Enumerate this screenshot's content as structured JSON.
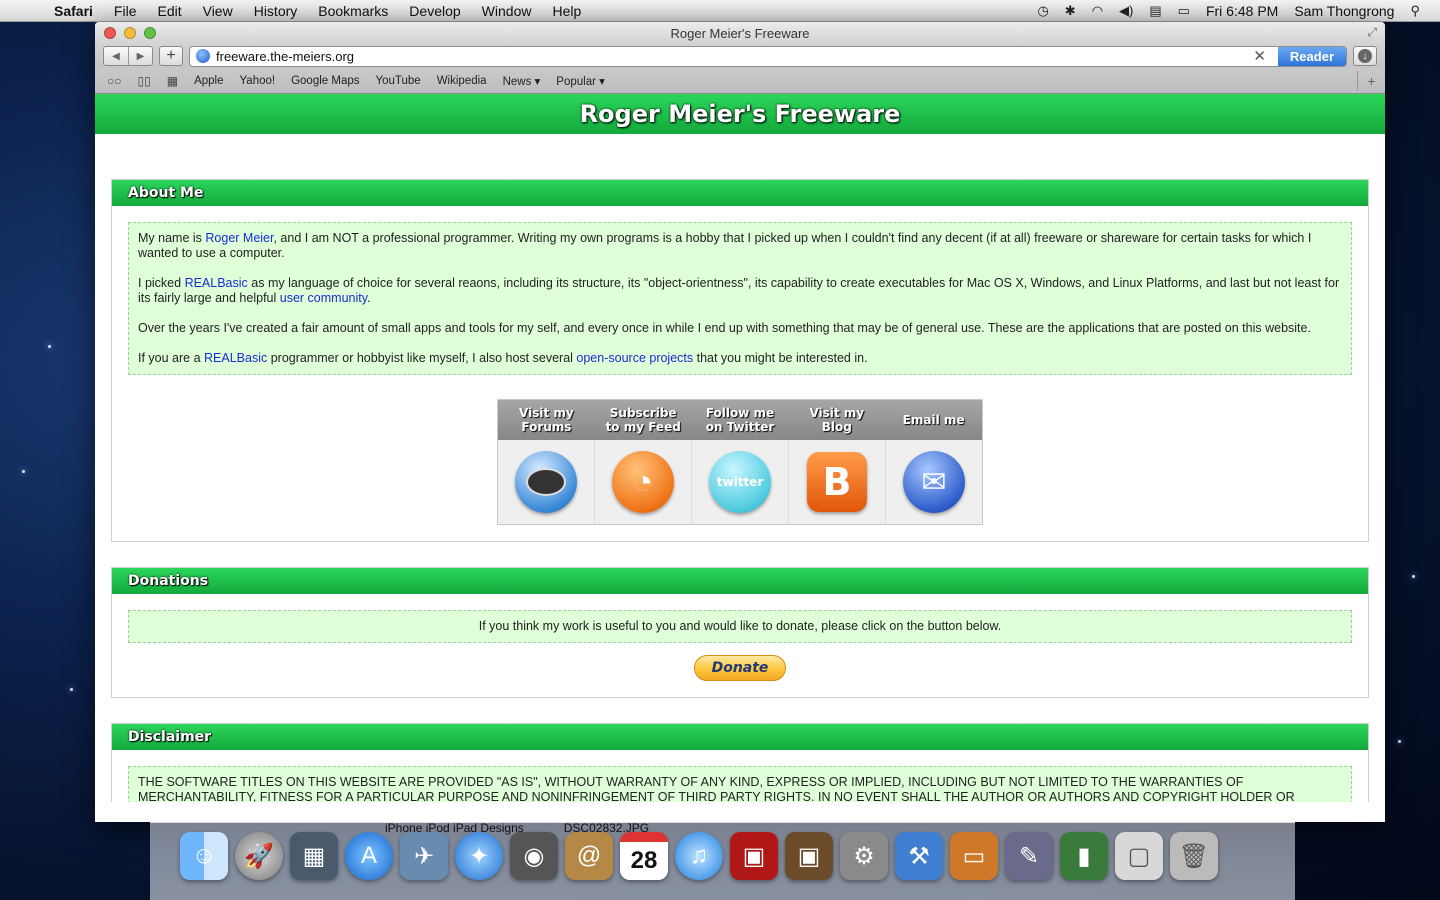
{
  "menubar": {
    "app": "Safari",
    "items": [
      "File",
      "Edit",
      "View",
      "History",
      "Bookmarks",
      "Develop",
      "Window",
      "Help"
    ],
    "clock": "Fri 6:48 PM",
    "user": "Sam Thongrong",
    "icons": [
      "time-machine-icon",
      "bluetooth-icon",
      "wifi-icon",
      "volume-icon",
      "flag-icon",
      "battery-icon",
      "spotlight-icon"
    ]
  },
  "window": {
    "title": "Roger Meier's Freeware",
    "url": "freeware.the-meiers.org",
    "reader_label": "Reader"
  },
  "bookmarks": [
    "Apple",
    "Yahoo!",
    "Google Maps",
    "YouTube",
    "Wikipedia",
    "News ▾",
    "Popular ▾"
  ],
  "site": {
    "title": "Roger Meier's Freeware",
    "about": {
      "heading": "About Me",
      "p1_a": "My name is ",
      "p1_link": "Roger Meier",
      "p1_b": ", and I am NOT a professional programmer. Writing my own programs is a hobby that I picked up when I couldn't find any decent (if at all) freeware or shareware for certain tasks for which I wanted to use a computer.",
      "p2_a": "I picked ",
      "p2_link1": "REALBasic",
      "p2_b": " as my language of choice for several reaons, including its structure, its \"object-orientness\", its capability to create executables for Mac OS X, Windows, and Linux Platforms, and last but not least for its fairly large and helpful ",
      "p2_link2": "user community",
      "p2_c": ".",
      "p3": "Over the years I've created a fair amount of small apps and tools for my self, and every once in while I end up with something that may be of general use. These are the applications that are posted on this website.",
      "p4_a": "If you are a ",
      "p4_link1": "REALBasic",
      "p4_b": " programmer or hobbyist like myself, I also host several ",
      "p4_link2": "open-source projects",
      "p4_c": " that you might be interested in."
    },
    "links": [
      {
        "label_1": "Visit my",
        "label_2": "Forums"
      },
      {
        "label_1": "Subscribe",
        "label_2": "to my Feed"
      },
      {
        "label_1": "Follow me",
        "label_2": "on Twitter"
      },
      {
        "label_1": "Visit my",
        "label_2": "Blog"
      },
      {
        "label_1": "Email me",
        "label_2": ""
      }
    ],
    "twitter_logo": "twitter",
    "blog_logo": "B",
    "donations": {
      "heading": "Donations",
      "text": "If you think my work is useful to you and would like to donate, please click on the button below.",
      "button": "Donate"
    },
    "disclaimer": {
      "heading": "Disclaimer",
      "text": "THE SOFTWARE TITLES ON THIS WEBSITE ARE PROVIDED \"AS IS\", WITHOUT WARRANTY OF ANY KIND, EXPRESS OR IMPLIED, INCLUDING BUT NOT LIMITED TO THE WARRANTIES OF MERCHANTABILITY, FITNESS FOR A PARTICULAR PURPOSE AND NONINFRINGEMENT OF THIRD PARTY RIGHTS. IN NO EVENT SHALL THE AUTHOR OR AUTHORS AND COPYRIGHT HOLDER OR HOLDERS"
    }
  },
  "dock": {
    "labels": [
      "iPhone iPod iPad Designs",
      "DSC02832.JPG"
    ],
    "calendar_date": "28",
    "icons": [
      "finder-icon",
      "launchpad-icon",
      "mission-control-icon",
      "app-store-icon",
      "mail-icon",
      "safari-icon",
      "facetime-icon",
      "contacts-icon",
      "calendar-icon",
      "itunes-icon",
      "photo-booth-icon",
      "iphoto-icon",
      "system-preferences-icon",
      "xcode-icon",
      "keynote-icon",
      "instruments-icon",
      "numbers-icon",
      "preview-icon",
      "trash-icon"
    ]
  }
}
